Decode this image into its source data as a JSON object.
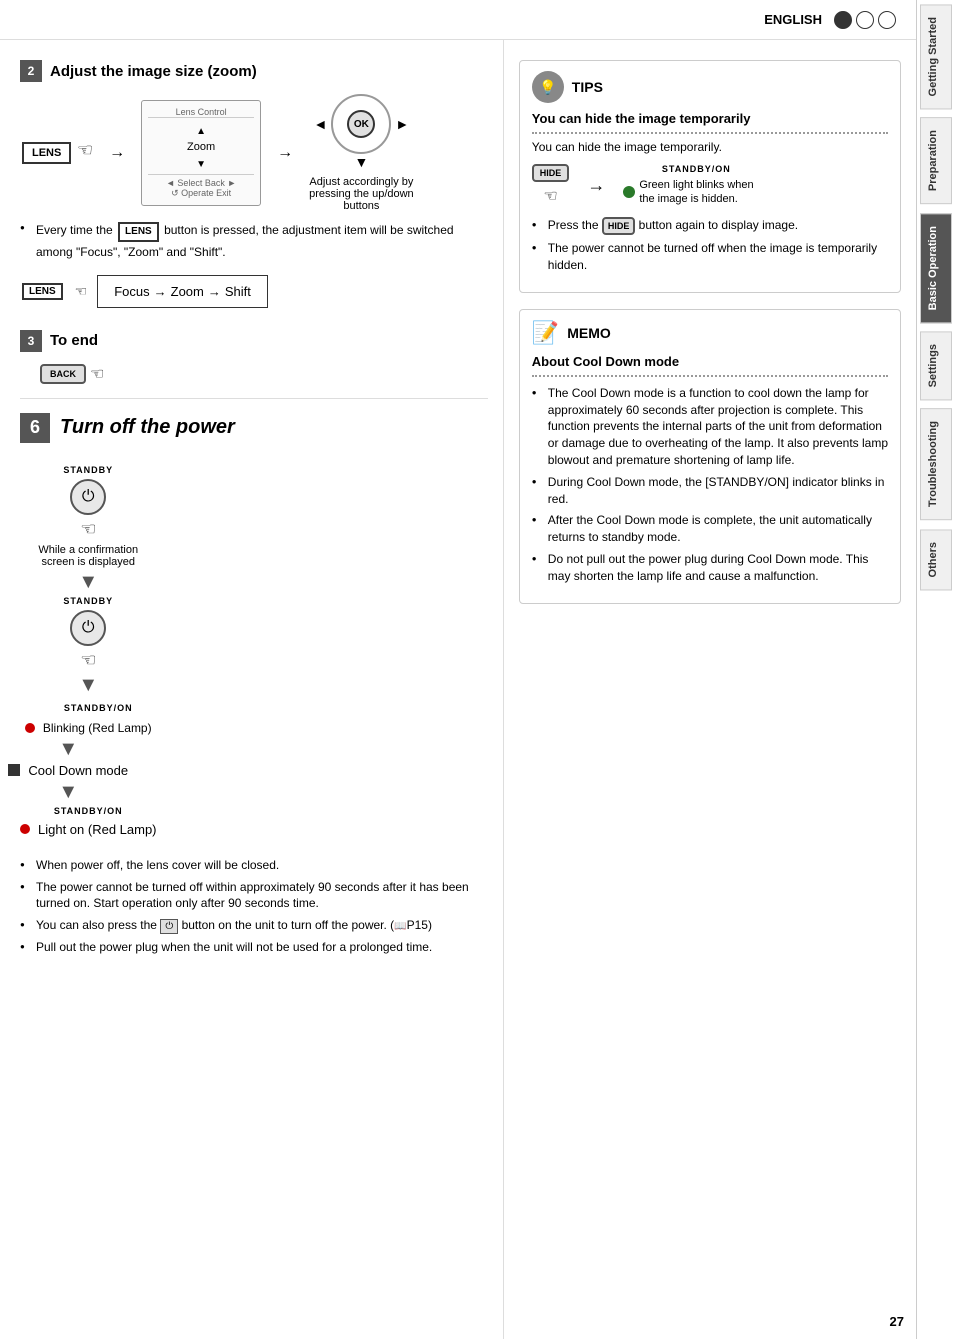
{
  "header": {
    "language": "ENGLISH",
    "circles": [
      "filled",
      "empty",
      "empty"
    ]
  },
  "page_number": "27",
  "sidebar": {
    "tabs": [
      {
        "label": "Getting Started",
        "active": false
      },
      {
        "label": "Preparation",
        "active": false
      },
      {
        "label": "Basic Operation",
        "active": true
      },
      {
        "label": "Settings",
        "active": false
      },
      {
        "label": "Troubleshooting",
        "active": false
      },
      {
        "label": "Others",
        "active": false
      }
    ]
  },
  "section2": {
    "number": "2",
    "title": "Adjust the image size (zoom)",
    "lens_control_title": "Lens Control",
    "zoom_label": "Zoom",
    "adjust_note": "Adjust accordingly by\npressing the up/down\nbuttons",
    "bullet1": "Every time the",
    "bullet1_mid": "button is pressed, the adjustment item\nwill be switched among \"Focus\", \"Zoom\" and \"Shift\".",
    "focus_zoom_shift": "Focus → Zoom → Shift"
  },
  "section3": {
    "number": "3",
    "title": "To end"
  },
  "section6": {
    "number": "6",
    "title": "Turn off the power",
    "standby_label1": "STANDBY",
    "standby_label2": "STANDBY",
    "standby_on_label1": "STANDBY/ON",
    "blinking_label": "Blinking (Red Lamp)",
    "cool_down_label": "Cool Down mode",
    "standby_on_label2": "STANDBY/ON",
    "light_on_label": "Light on (Red Lamp)",
    "while_confirmation": "While a confirmation\nscreen is displayed",
    "bullets": [
      "When power off, the lens cover will be closed.",
      "The power cannot be turned off within approximately 90 seconds after it has been turned on. Start operation only after 90 seconds time.",
      "You can also press the      button on the unit to turn off the power. (   P15)",
      "Pull out the power plug when the unit will not be used for a prolonged time."
    ]
  },
  "tips": {
    "icon": "💡",
    "label": "TIPS",
    "title": "You can hide the image temporarily",
    "body": "You can hide the image temporarily.",
    "hide_btn": "HIDE",
    "standby_on": "STANDBY/ON",
    "green_light": "Green light blinks\nwhen the image is\nhidden.",
    "bullets": [
      "Press the      button again to display image.",
      "The power cannot be turned off when the image is temporarily hidden."
    ]
  },
  "memo": {
    "icon": "📝",
    "label": "MEMO",
    "title": "About Cool Down mode",
    "bullets": [
      "The Cool Down mode is a function to cool down the lamp for approximately 60 seconds after projection is complete. This function prevents the internal parts of the unit from deformation or damage due to overheating of the lamp. It also prevents lamp blowout and premature shortening of lamp life.",
      "During Cool Down mode, the [STANDBY/ON] indicator blinks in red.",
      "After the Cool Down mode is complete, the unit automatically returns to standby mode.",
      "Do not pull out the power plug during Cool Down mode. This may shorten the lamp life and cause a malfunction."
    ]
  }
}
